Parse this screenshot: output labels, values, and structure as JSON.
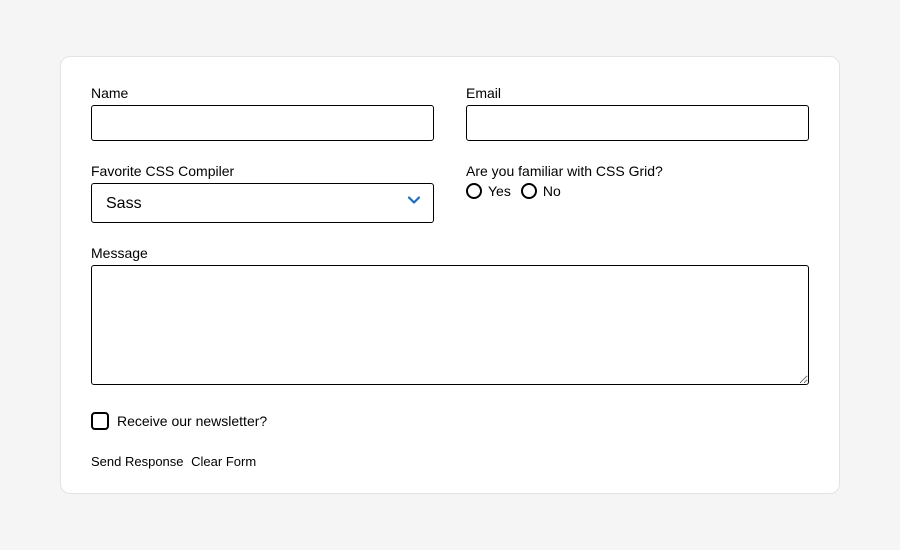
{
  "form": {
    "name": {
      "label": "Name",
      "value": ""
    },
    "email": {
      "label": "Email",
      "value": ""
    },
    "compiler": {
      "label": "Favorite CSS Compiler",
      "selected": "Sass"
    },
    "grid_familiar": {
      "label": "Are you familiar with CSS Grid?",
      "options": {
        "yes": "Yes",
        "no": "No"
      }
    },
    "message": {
      "label": "Message",
      "value": ""
    },
    "newsletter": {
      "label": "Receive our newsletter?",
      "checked": false
    },
    "actions": {
      "submit": "Send Response",
      "clear": "Clear Form"
    }
  },
  "colors": {
    "accent": "#1b6ec2"
  }
}
